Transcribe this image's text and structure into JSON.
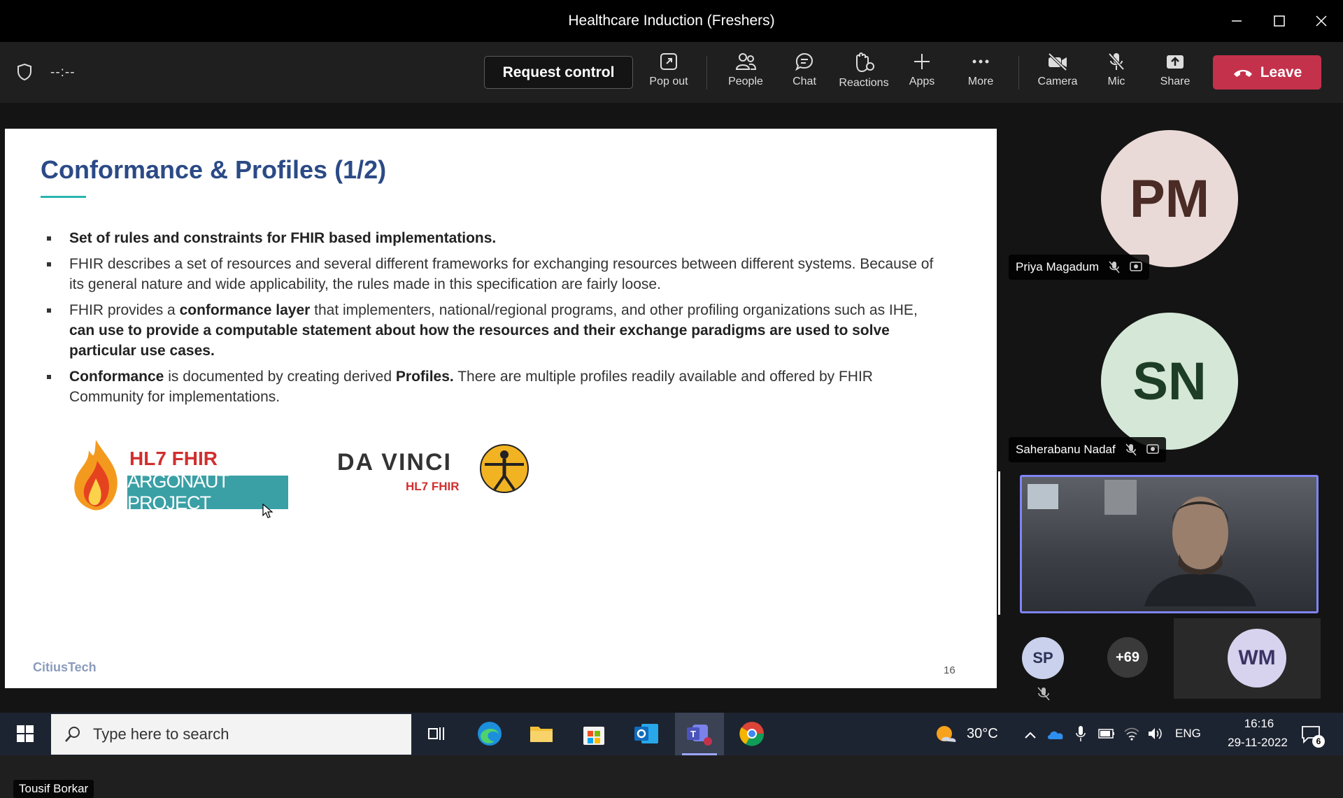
{
  "window": {
    "title": "Healthcare Induction (Freshers)"
  },
  "toolbar": {
    "timer": "--:--",
    "request_control": "Request control",
    "pop_out": "Pop out",
    "people": "People",
    "chat": "Chat",
    "reactions": "Reactions",
    "apps": "Apps",
    "more": "More",
    "camera": "Camera",
    "mic": "Mic",
    "share": "Share",
    "leave": "Leave"
  },
  "slide": {
    "title": "Conformance & Profiles (1/2)",
    "bullets": [
      {
        "parts": [
          {
            "text": "Set of rules and constraints for FHIR based implementations.",
            "bold": true
          }
        ]
      },
      {
        "parts": [
          {
            "text": "FHIR describes a set of resources and several different frameworks for exchanging resources between different systems. Because of its general nature and wide applicability, the rules made in this specification are fairly loose.",
            "bold": false
          }
        ]
      },
      {
        "parts": [
          {
            "text": "FHIR provides a ",
            "bold": false
          },
          {
            "text": "conformance layer",
            "bold": true
          },
          {
            "text": " that implementers, national/regional programs, and other profiling organizations such as IHE, ",
            "bold": false
          },
          {
            "text": "can use to provide a computable statement about how the resources and their exchange paradigms are used to solve particular use cases.",
            "bold": true
          }
        ]
      },
      {
        "parts": [
          {
            "text": "Conformance",
            "bold": true
          },
          {
            "text": " is documented by creating derived ",
            "bold": false
          },
          {
            "text": "Profiles.",
            "bold": true
          },
          {
            "text": " There are multiple profiles readily available and offered by FHIR Community for implementations.",
            "bold": false
          }
        ]
      }
    ],
    "logo_hl7": "HL7 FHIR",
    "logo_argonaut": "ARGONAUT PROJECT",
    "logo_davinci": "DA VINCI",
    "logo_davinci_sub": "HL7 FHIR",
    "brand": "CitiusTech",
    "page_number": "16",
    "presenter": "Tousif Borkar"
  },
  "participants": [
    {
      "initials": "PM",
      "name": "Priya Magadum",
      "bg": "#eadad7",
      "fg": "#4a2b25"
    },
    {
      "initials": "SN",
      "name": "Saherabanu Nadaf",
      "bg": "#d5e8d8",
      "fg": "#1e3d27"
    }
  ],
  "small_participants": {
    "sp": {
      "initials": "SP",
      "bg": "#c9d1ec",
      "fg": "#2a3358"
    },
    "overflow": "+69",
    "wm": {
      "initials": "WM",
      "bg": "#d7d3ef",
      "fg": "#3a3364"
    }
  },
  "taskbar": {
    "search_placeholder": "Type here to search",
    "weather": "30°C",
    "language": "ENG",
    "time": "16:16",
    "date": "29-11-2022",
    "notifications": "6"
  },
  "colors": {
    "leave": "#c4314b",
    "slide_title": "#2b4a86",
    "accent": "#7f85f5"
  }
}
